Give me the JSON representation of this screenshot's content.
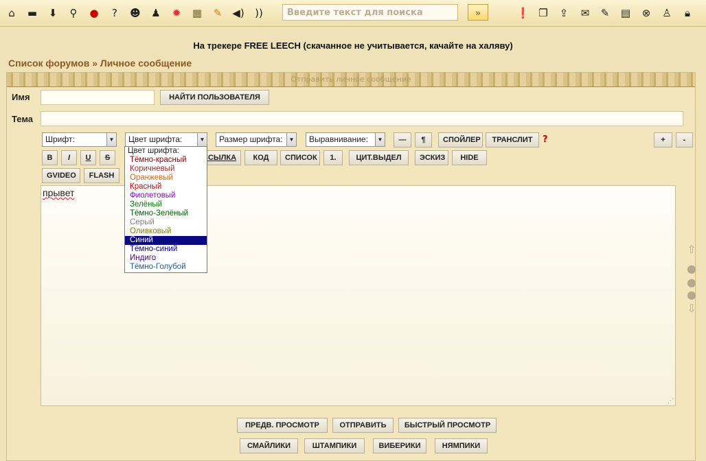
{
  "toolbar": {
    "icons_left": [
      "home-icon",
      "comment-icon",
      "download-icon",
      "search-icon",
      "record-icon",
      "help-icon",
      "group-icon",
      "users-icon",
      "star-burst-icon",
      "calculator-icon",
      "tag-icon",
      "speaker-icon",
      "rss-icon"
    ],
    "search_placeholder": "Введите текст для поиска",
    "search_button": "»",
    "icons_right": [
      "alert-icon",
      "copy-icon",
      "upload-icon",
      "mail-icon",
      "edit-icon",
      "document-icon",
      "close-circle-icon",
      "user-icon",
      "lock-icon"
    ]
  },
  "notice": "На трекере FREE LEECH (скачанное не учитывается, качайте на халяву)",
  "breadcrumb": {
    "forums": "Список форумов",
    "sep": "»",
    "current": "Личное сообщение"
  },
  "panel": {
    "title": "Отправить личное сообщение"
  },
  "form": {
    "name_label": "Имя",
    "name_value": "",
    "find_user_button": "НАЙТИ ПОЛЬЗОВАТЕЛЯ",
    "subject_label": "Тема",
    "subject_value": ""
  },
  "editor_toolbar": {
    "font_select": "Шрифт:",
    "color_select": "Цвет шрифта:",
    "size_select": "Размер шрифта:",
    "align_select": "Выравнивание:",
    "hr_button": "—",
    "para_button": "¶",
    "spoiler_button": "СПОЙЛЕР",
    "translit_button": "ТРАНСЛИТ",
    "help_mark": "?",
    "plus_button": "+",
    "minus_button": "-",
    "bold": "B",
    "italic": "I",
    "underline": "U",
    "strike": "S",
    "link_button": "ССЫЛКА",
    "code_button": "КОД",
    "list_button": "СПИСОК",
    "numlist_button": "1.",
    "quote_button": "ЦИТ.ВЫДЕЛ",
    "sketch_button": "ЭСКИЗ",
    "hide_button": "HIDE",
    "gvideo_button": "GVIDEO",
    "flash_button": "FLASH"
  },
  "color_options": [
    {
      "label": "Цвет шрифта:",
      "color": "#222222"
    },
    {
      "label": "Тёмно-красный",
      "color": "#8b0000"
    },
    {
      "label": "Коричневый",
      "color": "#a52a2a"
    },
    {
      "label": "Оранжевый",
      "color": "#d2691e"
    },
    {
      "label": "Красный",
      "color": "#dd0000"
    },
    {
      "label": "Фиолетовый",
      "color": "#9400d3"
    },
    {
      "label": "Зелёный",
      "color": "#008000"
    },
    {
      "label": "Тёмно-Зелёный",
      "color": "#006400"
    },
    {
      "label": "Серый",
      "color": "#808080"
    },
    {
      "label": "Оливковый",
      "color": "#808000"
    },
    {
      "label": "Синий",
      "color": "#0000ff",
      "selected": true
    },
    {
      "label": "Тёмно-синий",
      "color": "#00008b"
    },
    {
      "label": "Индиго",
      "color": "#4b0082"
    },
    {
      "label": "Тёмно-Голубой",
      "color": "#1e5b9b"
    }
  ],
  "editor": {
    "text": "прывет"
  },
  "actions": {
    "preview": "ПРЕДВ. ПРОСМОТР",
    "send": "ОТПРАВИТЬ",
    "quick_preview": "БЫСТРЫЙ ПРОСМОТР",
    "smileys": "СМАЙЛИКИ",
    "stamps": "ШТАМПИКИ",
    "viberiki": "ВИБЕРИКИ",
    "nyampiki": "НЯМПИКИ"
  }
}
